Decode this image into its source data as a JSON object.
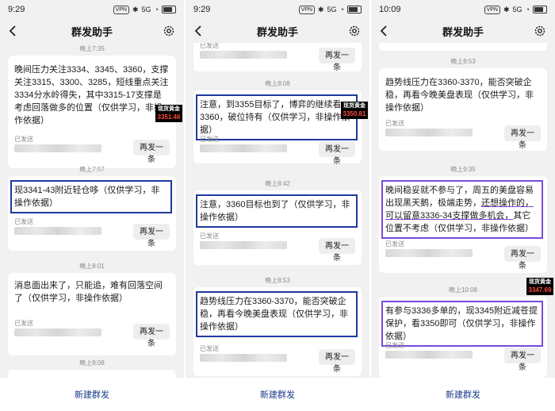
{
  "panels": [
    {
      "status": {
        "time": "9:29"
      },
      "header": {
        "title": "群发助手"
      },
      "messages": [
        {
          "text": "晚间压力关注3334、3345、3360，支撑关注3315、3300、3285，短线重点关注3334分水岭得失，其中3315-17支撑是考虑回落做多的位置（仅供学习，非操作依据）",
          "sent": "已发送",
          "resend": "再发一条"
        },
        {
          "time": "晚上7:57",
          "text": "现3341-43附近轻仓哆（仅供学习，非操作依据）",
          "sent": "已发送",
          "resend": "再发一条"
        },
        {
          "time": "晚上8:01",
          "text": "消息面出来了，只能追，难有回落空间了（仅供学习，非操作依据）",
          "sent": "已发送",
          "resend": "再发一条"
        },
        {
          "time": "晚上8:08"
        }
      ],
      "top_time": "晚上7:35",
      "badge": {
        "label": "现货黄金",
        "price": "3351.46"
      },
      "bottom": {
        "new_group": "新建群发"
      }
    },
    {
      "status": {
        "time": "9:29"
      },
      "header": {
        "title": "群发助手"
      },
      "messages": [
        {
          "sent": "已发送",
          "resend": "再发一条"
        },
        {
          "time": "晚上8:08",
          "text": "注意，到3355目标了，博弈的继续看3360，破位持有（仅供学习，非操作依据）",
          "sent": "已发送",
          "resend": "再发一条"
        },
        {
          "time": "晚上8:42",
          "text": "注意，3360目标也到了（仅供学习，非操作依据）",
          "sent": "已发送",
          "resend": "再发一条"
        },
        {
          "time": "晚上8:53",
          "text": "趋势线压力在3360-3370，能否突破企稳，再看今晚美盘表现（仅供学习，非操作依据）",
          "sent": "已发送",
          "resend": "再发一条"
        }
      ],
      "badge": {
        "label": "现货黄金",
        "price": "3350.81"
      },
      "bottom": {
        "new_group": "新建群发"
      }
    },
    {
      "status": {
        "time": "10:09"
      },
      "header": {
        "title": "群发助手"
      },
      "messages": [
        {
          "sent": "已发送",
          "resend": "再发一条"
        },
        {
          "time": "晚上8:53",
          "text": "趋势线压力在3360-3370，能否突破企稳，再看今晚美盘表现（仅供学习，非操作依据）",
          "sent": "已发送",
          "resend": "再发一条"
        },
        {
          "time": "晚上9:35",
          "text_a": "晚间稳妥就不参与了，周五的美盘容易出现黑天鹅，极端走势，",
          "text_u": "还想操作的，可以留意3336-34支撑做多机会，",
          "text_b": "其它位置不考虑（仅供学习，非操作依据）",
          "sent": "已发送",
          "resend": "再发一条"
        },
        {
          "time": "晚上10:08",
          "text": "有参与3336多单的，现3345附近减苍提保护，看3350即可（仅供学习，非操作依据）",
          "sent": "已发送",
          "resend": "再发一条"
        }
      ],
      "badge": {
        "label": "现货黄金",
        "price": "3347.69"
      },
      "bottom": {
        "new_group": "新建群发"
      }
    }
  ],
  "status_icons": {
    "vpn": "VPN",
    "signal": "5G",
    "battery_pct": "100"
  },
  "colors": {
    "highlight_blue": "#1f3a9e",
    "highlight_purple": "#7a4ad8",
    "price_red": "#ff4a3a"
  },
  "icons": [
    "back-arrow-icon",
    "gear-icon",
    "battery-icon",
    "wifi-icon",
    "bluetooth-icon"
  ]
}
